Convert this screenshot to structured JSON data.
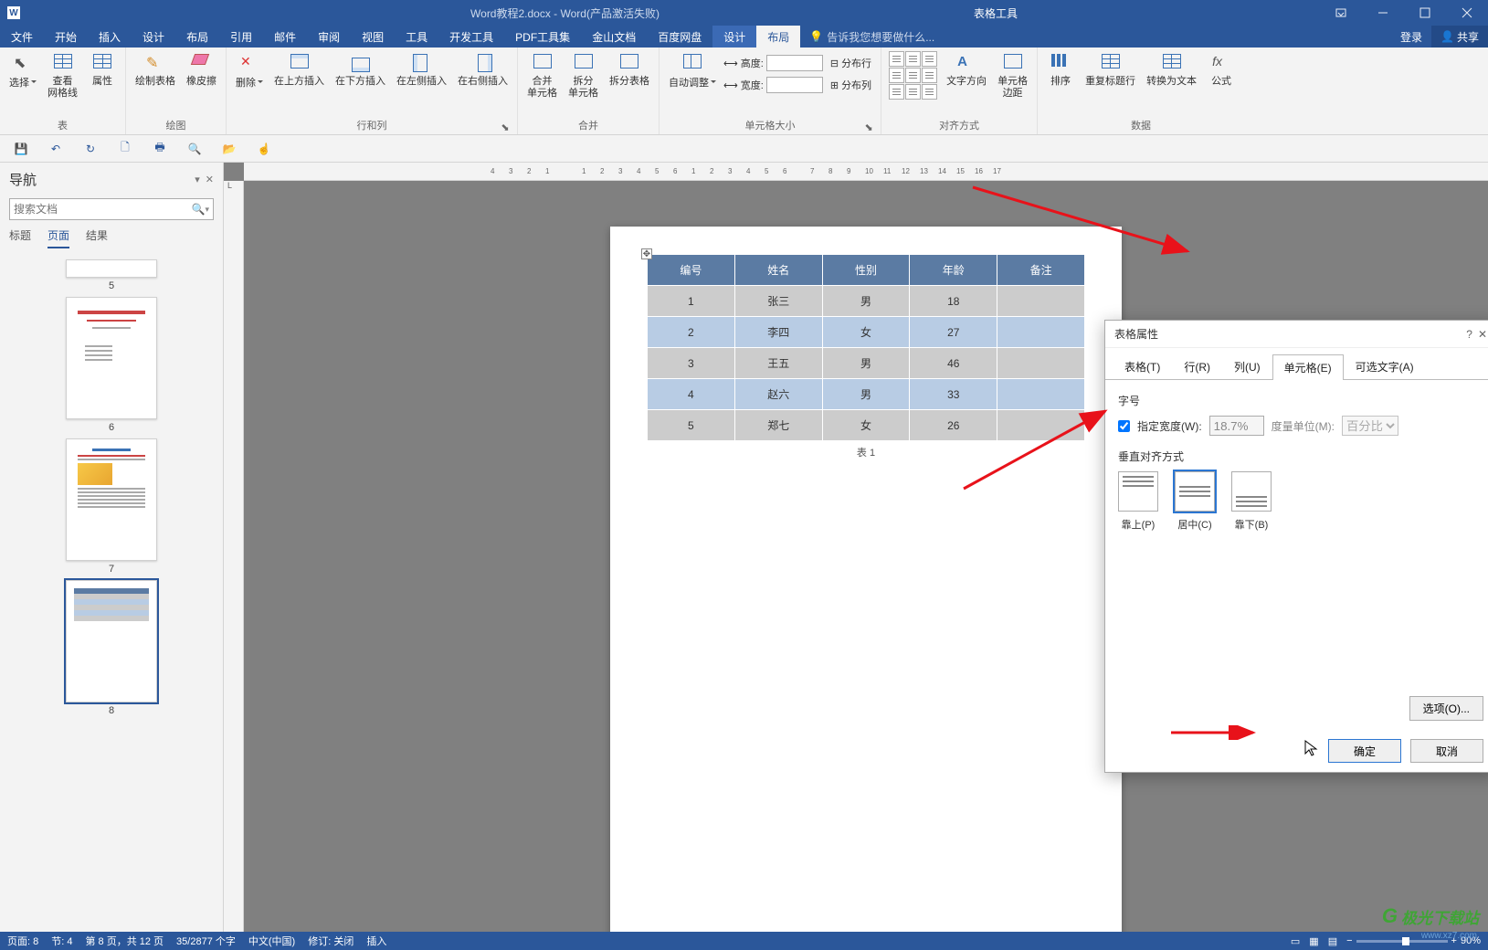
{
  "title": {
    "document": "Word教程2.docx - Word(产品激活失败)",
    "context": "表格工具"
  },
  "menu": {
    "items": [
      "文件",
      "开始",
      "插入",
      "设计",
      "布局",
      "引用",
      "邮件",
      "审阅",
      "视图",
      "工具",
      "开发工具",
      "PDF工具集",
      "金山文档",
      "百度网盘"
    ],
    "ctx_items": [
      "设计",
      "布局"
    ],
    "active": "布局",
    "tellme": "告诉我您想要做什么...",
    "login": "登录",
    "share": "共享"
  },
  "ribbon": {
    "groups": {
      "table": {
        "label": "表",
        "select": "选择",
        "gridlines": "查看\n网格线",
        "properties": "属性"
      },
      "draw": {
        "label": "绘图",
        "draw": "绘制表格",
        "eraser": "橡皮擦"
      },
      "rowscols": {
        "label": "行和列",
        "delete": "删除",
        "insabove": "在上方插入",
        "insbelow": "在下方插入",
        "insleft": "在左侧插入",
        "insright": "在右侧插入"
      },
      "merge": {
        "label": "合并",
        "merge": "合并\n单元格",
        "split": "拆分\n单元格",
        "splittbl": "拆分表格"
      },
      "size": {
        "label": "单元格大小",
        "autofit": "自动调整",
        "height": "高度:",
        "width": "宽度:",
        "distR": "分布行",
        "distC": "分布列"
      },
      "align": {
        "label": "对齐方式",
        "textdir": "文字方向",
        "margins": "单元格\n边距"
      },
      "data": {
        "label": "数据",
        "sort": "排序",
        "repeat": "重复标题行",
        "convert": "转换为文本",
        "formula": "公式"
      }
    }
  },
  "nav": {
    "title": "导航",
    "search_placeholder": "搜索文档",
    "tabs": {
      "headings": "标题",
      "pages": "页面",
      "results": "结果"
    },
    "page_numbers": [
      "5",
      "6",
      "7",
      "8"
    ]
  },
  "table": {
    "caption": "表 1",
    "headers": [
      "编号",
      "姓名",
      "性别",
      "年龄",
      "备注"
    ],
    "rows": [
      [
        "1",
        "张三",
        "男",
        "18",
        ""
      ],
      [
        "2",
        "李四",
        "女",
        "27",
        ""
      ],
      [
        "3",
        "王五",
        "男",
        "46",
        ""
      ],
      [
        "4",
        "赵六",
        "男",
        "33",
        ""
      ],
      [
        "5",
        "郑七",
        "女",
        "26",
        ""
      ]
    ]
  },
  "dialog": {
    "title": "表格属性",
    "tabs": {
      "table": "表格(T)",
      "row": "行(R)",
      "column": "列(U)",
      "cell": "单元格(E)",
      "alt": "可选文字(A)"
    },
    "active_tab": "cell",
    "size_header": "字号",
    "pref_width": "指定宽度(W):",
    "pref_value": "18.7%",
    "unit_label": "度量单位(M):",
    "unit_value": "百分比",
    "valign_header": "垂直对齐方式",
    "valign": {
      "top": "靠上(P)",
      "center": "居中(C)",
      "bottom": "靠下(B)"
    },
    "options": "选项(O)...",
    "ok": "确定",
    "cancel": "取消"
  },
  "status": {
    "page": "页面: 8",
    "section": "节: 4",
    "pagecount": "第 8 页，共 12 页",
    "words": "35/2877 个字",
    "lang": "中文(中国)",
    "track": "修订: 关闭",
    "insert": "插入",
    "zoom": "90%"
  },
  "watermark": {
    "brand": "极光下载站",
    "url": "www.xz7.com"
  }
}
